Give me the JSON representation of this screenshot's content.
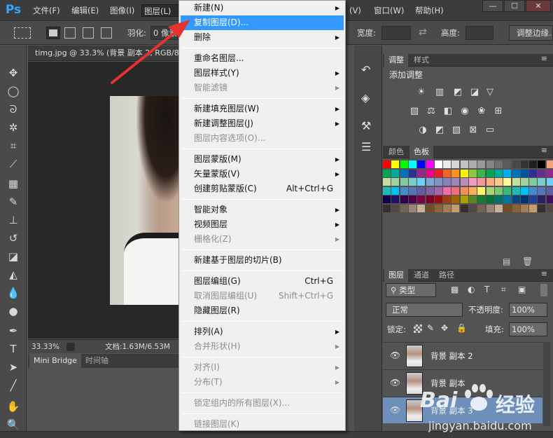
{
  "menubar": {
    "logo": "Ps",
    "items": [
      "文件(F)",
      "编辑(E)",
      "图像(I)",
      "图层(L)"
    ],
    "items_right": [
      "(V)",
      "窗口(W)",
      "帮助(H)"
    ],
    "window_buttons": [
      "—",
      "☐",
      "✕"
    ]
  },
  "options": {
    "feather_label": "羽化:",
    "feather_value": "0 像素",
    "width_label": "宽度:",
    "height_label": "高度:",
    "refine_edge_button": "调整边缘..."
  },
  "document": {
    "tab_title": "timg.jpg @ 33.3% (背景 副本 2, RGB/8",
    "zoom": "33.33%",
    "doc_size": "文档:1.63M/6.53M"
  },
  "bottom_panel": {
    "tabs": [
      "Mini Bridge",
      "时间轴"
    ]
  },
  "layer_menu": {
    "items": [
      {
        "label": "新建(N)",
        "arrow": true
      },
      {
        "label": "复制图层(D)...",
        "highlighted": true
      },
      {
        "label": "删除",
        "arrow": true
      },
      {
        "sep": true
      },
      {
        "label": "重命名图层..."
      },
      {
        "label": "图层样式(Y)",
        "arrow": true
      },
      {
        "label": "智能滤镜",
        "disabled": true,
        "arrow": true
      },
      {
        "sep": true
      },
      {
        "label": "新建填充图层(W)",
        "arrow": true
      },
      {
        "label": "新建调整图层(J)",
        "arrow": true
      },
      {
        "label": "图层内容选项(O)...",
        "disabled": true
      },
      {
        "sep": true
      },
      {
        "label": "图层蒙版(M)",
        "arrow": true
      },
      {
        "label": "矢量蒙版(V)",
        "arrow": true
      },
      {
        "label": "创建剪贴蒙版(C)",
        "shortcut": "Alt+Ctrl+G"
      },
      {
        "sep": true
      },
      {
        "label": "智能对象",
        "arrow": true
      },
      {
        "label": "视频图层",
        "arrow": true
      },
      {
        "label": "栅格化(Z)",
        "disabled": true,
        "arrow": true
      },
      {
        "sep": true
      },
      {
        "label": "新建基于图层的切片(B)"
      },
      {
        "sep": true
      },
      {
        "label": "图层编组(G)",
        "shortcut": "Ctrl+G"
      },
      {
        "label": "取消图层编组(U)",
        "shortcut": "Shift+Ctrl+G",
        "disabled": true
      },
      {
        "label": "隐藏图层(R)"
      },
      {
        "sep": true
      },
      {
        "label": "排列(A)",
        "arrow": true
      },
      {
        "label": "合并形状(H)",
        "disabled": true,
        "arrow": true
      },
      {
        "sep": true
      },
      {
        "label": "对齐(I)",
        "disabled": true,
        "arrow": true
      },
      {
        "label": "分布(T)",
        "disabled": true,
        "arrow": true
      },
      {
        "sep": true
      },
      {
        "label": "锁定组内的所有图层(X)...",
        "disabled": true
      },
      {
        "sep": true
      },
      {
        "label": "链接图层(K)",
        "disabled": true
      }
    ]
  },
  "adjustments": {
    "tabs": [
      "调整",
      "样式"
    ],
    "title": "添加调整"
  },
  "swatches": {
    "tabs": [
      "颜色",
      "色板"
    ]
  },
  "layers": {
    "tabs": [
      "图层",
      "通道",
      "路径"
    ],
    "filter_kind": "类型",
    "blend_mode": "正常",
    "opacity_label": "不透明度:",
    "opacity_value": "100%",
    "lock_label": "锁定:",
    "fill_label": "填充:",
    "fill_value": "100%",
    "rows": [
      {
        "name": "背景 副本 2"
      },
      {
        "name": "背景 副本"
      },
      {
        "name": "背景 副本 3",
        "selected": true
      }
    ]
  },
  "watermark": {
    "brand": "Bai",
    "brand_cn": "经验",
    "url": "jingyan.baidu.com"
  },
  "colors": {
    "highlight": "#3399ff",
    "arrow": "#e8322d"
  }
}
